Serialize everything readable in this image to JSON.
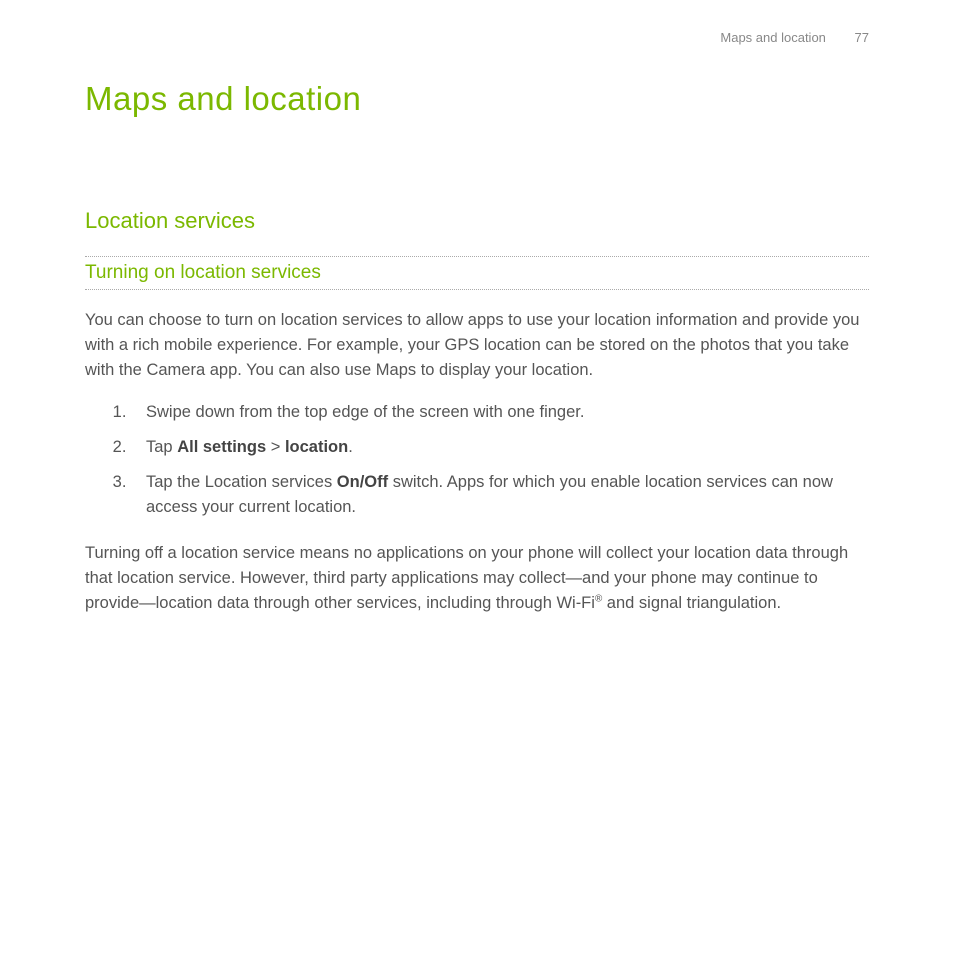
{
  "header": {
    "section": "Maps and location",
    "page": "77"
  },
  "title": "Maps and location",
  "h2": "Location services",
  "h3": "Turning on location services",
  "intro": "You can choose to turn on location services to allow apps to use your location information and provide you with a rich mobile experience. For example, your GPS location can be stored on the photos that you take with the Camera app. You can also use Maps to display your location.",
  "step1": "Swipe down from the top edge of the screen with one finger.",
  "step2_a": "Tap ",
  "step2_b": "All settings",
  "step2_c": " > ",
  "step2_d": "location",
  "step2_e": ".",
  "step3_a": "Tap the Location services ",
  "step3_b": "On/Off",
  "step3_c": " switch. Apps for which you enable location services can now access your current location.",
  "outro_a": "Turning off a location service means no applications on your phone will collect your location data through that location service. However, third party applications may collect—and your phone may continue to provide—location data through other services, including through Wi-Fi",
  "outro_sup": "®",
  "outro_b": " and signal triangulation."
}
